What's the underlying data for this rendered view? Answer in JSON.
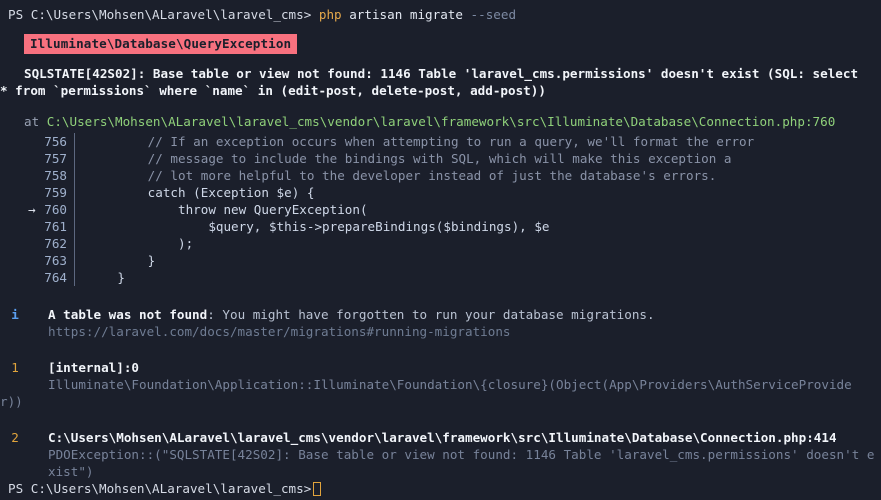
{
  "terminal": {
    "background_color": "#1b1f2b",
    "prompt": {
      "prefix": "PS C:\\Users\\Mohsen\\ALaravel\\laravel_cms> ",
      "binary": "php",
      "args": " artisan migrate ",
      "flag": "--seed"
    },
    "exception_badge": {
      "label": "Illuminate\\Database\\QueryException",
      "background_color": "#f8717f",
      "text_color": "#1b1f2b"
    },
    "message": {
      "line1": "SQLSTATE[42S02]: Base table or view not found: 1146 Table 'laravel_cms.permissions' doesn't exist (SQL: select",
      "line2": "* from `permissions` where `name` in (edit-post, delete-post, add-post))"
    },
    "at_frame": {
      "keyword": "at ",
      "path": "C:\\Users\\Mohsen\\ALaravel\\laravel_cms\\vendor\\laravel\\framework\\src\\Illuminate\\Database\\Connection.php:760"
    },
    "code_listing": [
      {
        "arrow": "",
        "number": "756",
        "code": "        // If an exception occurs when attempting to run a query, we'll format the error",
        "comment": true
      },
      {
        "arrow": "",
        "number": "757",
        "code": "        // message to include the bindings with SQL, which will make this exception a",
        "comment": true
      },
      {
        "arrow": "",
        "number": "758",
        "code": "        // lot more helpful to the developer instead of just the database's errors.",
        "comment": true
      },
      {
        "arrow": "",
        "number": "759",
        "code": "        catch (Exception $e) {",
        "comment": false
      },
      {
        "arrow": "→",
        "number": "760",
        "code": "            throw new QueryException(",
        "comment": false
      },
      {
        "arrow": "",
        "number": "761",
        "code": "                $query, $this->prepareBindings($bindings), $e",
        "comment": false
      },
      {
        "arrow": "",
        "number": "762",
        "code": "            );",
        "comment": false
      },
      {
        "arrow": "",
        "number": "763",
        "code": "        }",
        "comment": false
      },
      {
        "arrow": "",
        "number": "764",
        "code": "    }",
        "comment": false
      }
    ],
    "hint": {
      "icon": "i",
      "icon_name": "info-icon",
      "icon_color": "#5b9ff0",
      "title": "A table was not found",
      "text": ": You might have forgotten to run your database migrations.",
      "url": "https://laravel.com/docs/master/migrations#running-migrations"
    },
    "frames": [
      {
        "number": "1",
        "title": "[internal]:0",
        "detail": "Illuminate\\Foundation\\Application::Illuminate\\Foundation\\{closure}(Object(App\\Providers\\AuthServiceProvide",
        "detail_overflow": "r))"
      },
      {
        "number": "2",
        "title": "C:\\Users\\Mohsen\\ALaravel\\laravel_cms\\vendor\\laravel\\framework\\src\\Illuminate\\Database\\Connection.php:414",
        "detail": "PDOException::(\"SQLSTATE[42S02]: Base table or view not found: 1146 Table 'laravel_cms.permissions' doesn't exist\")",
        "detail_overflow": ""
      }
    ],
    "tail_prompt": "PS C:\\Users\\Mohsen\\ALaravel\\laravel_cms>"
  }
}
